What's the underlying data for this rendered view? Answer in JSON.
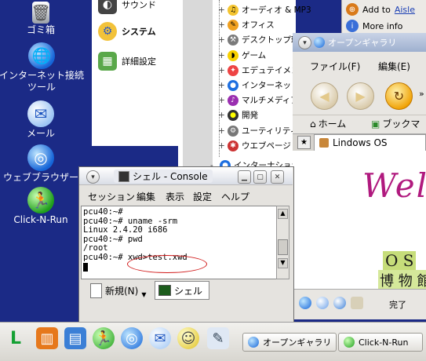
{
  "desktop": {
    "icons": [
      {
        "label": "ゴミ箱"
      },
      {
        "label": "インターネット接続\nツール"
      },
      {
        "label": "メール"
      },
      {
        "label": "ウェブブラウザー"
      },
      {
        "label": "Click-N-Run"
      }
    ]
  },
  "control_panel": {
    "items": [
      {
        "label": "サウンド"
      },
      {
        "label": "システム"
      },
      {
        "label": "詳細設定"
      }
    ]
  },
  "menu_tree": {
    "items": [
      {
        "label": "オーディオ & MP3"
      },
      {
        "label": "オフィス"
      },
      {
        "label": "デスクトップ環"
      },
      {
        "label": "ゲーム"
      },
      {
        "label": "エデュテイメン"
      },
      {
        "label": "インターネット"
      },
      {
        "label": "マルチメディア"
      },
      {
        "label": "開発"
      },
      {
        "label": "ユーティリティー"
      },
      {
        "label": "ウエブページ"
      },
      {
        "label": "インターナショナル"
      }
    ]
  },
  "aisle_panel": {
    "add_to": "Add to",
    "aisle_link": "Aisle",
    "more_info": "More info"
  },
  "browser": {
    "title": "オープンギャラリ",
    "menu": [
      "ファイル(F)",
      "編集(E)"
    ],
    "bookmarks": [
      "ホーム",
      "ブックマ"
    ],
    "tab_label": "Lindows OS",
    "welcome_fragment": "Wel",
    "page_text_1": "O S",
    "page_text_2": "博 物 館",
    "status": "完了"
  },
  "konsole": {
    "title": "シェル - Console",
    "menu": [
      "セッション",
      "編集",
      "表示",
      "設定",
      "ヘルプ"
    ],
    "terminal_lines": [
      "pcu40:~#",
      "pcu40:~# uname -srm",
      "Linux 2.4.20 i686",
      "pcu40:~# pwd",
      "/root",
      "pcu40:~# xwd>test.xwd"
    ],
    "new_tab_label": "新規(N)",
    "session_tab_label": "シェル"
  },
  "taskbar": {
    "tasks": [
      {
        "label": "オープンギャラリー"
      },
      {
        "label": "Click-N-Run"
      }
    ]
  },
  "colors": {
    "desktop_bg": "#1b2a86",
    "annotation_red": "#d11b1b",
    "welcome_magenta": "#b0197e",
    "oss_green": "#8fb63a"
  }
}
